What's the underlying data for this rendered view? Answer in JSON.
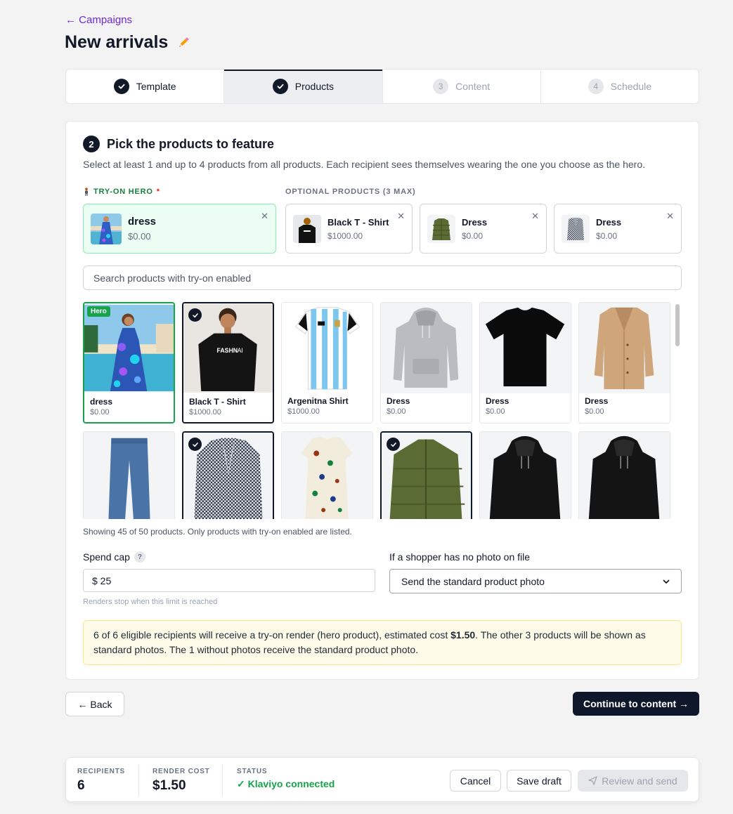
{
  "nav": {
    "back_link": "← Campaigns"
  },
  "page": {
    "title": "New arrivals"
  },
  "stepper": [
    {
      "label": "Template",
      "state": "done"
    },
    {
      "label": "Products",
      "state": "active"
    },
    {
      "label": "Content",
      "number": "3",
      "state": "pending"
    },
    {
      "label": "Schedule",
      "number": "4",
      "state": "pending"
    }
  ],
  "section": {
    "number": "2",
    "title": "Pick the products to feature",
    "description": "Select at least 1 and up to 4 products from all products. Each recipient sees themselves wearing the one you choose as the hero."
  },
  "hero_label": "TRY-ON HERO",
  "hero_required": "*",
  "optional_label": "OPTIONAL PRODUCTS (3 MAX)",
  "hero_slot": {
    "name": "dress",
    "price": "$0.00"
  },
  "optional_slots": [
    {
      "name": "Black T - Shirt",
      "price": "$1000.00"
    },
    {
      "name": "Dress",
      "price": "$0.00"
    },
    {
      "name": "Dress",
      "price": "$0.00"
    }
  ],
  "search": {
    "placeholder": "Search products with try-on enabled"
  },
  "products": [
    {
      "name": "dress",
      "price": "$0.00",
      "state": "hero",
      "badge": "Hero",
      "image": "floral-dress"
    },
    {
      "name": "Black T - Shirt",
      "price": "$1000.00",
      "state": "selected",
      "image": "black-tshirt-model"
    },
    {
      "name": "Argenitna Shirt",
      "price": "$1000.00",
      "state": "none",
      "image": "argentina-jersey"
    },
    {
      "name": "Dress",
      "price": "$0.00",
      "state": "none",
      "image": "grey-hoodie"
    },
    {
      "name": "Dress",
      "price": "$0.00",
      "state": "none",
      "image": "black-tshirt"
    },
    {
      "name": "Dress",
      "price": "$0.00",
      "state": "none",
      "image": "camel-coat"
    },
    {
      "name": "",
      "price": "",
      "state": "none",
      "image": "jeans"
    },
    {
      "name": "",
      "price": "",
      "state": "selected",
      "image": "houndstooth-blazer"
    },
    {
      "name": "",
      "price": "",
      "state": "none",
      "image": "print-dress"
    },
    {
      "name": "",
      "price": "",
      "state": "selected",
      "image": "green-puffer"
    },
    {
      "name": "",
      "price": "",
      "state": "none",
      "image": "black-hoodie"
    },
    {
      "name": "",
      "price": "",
      "state": "none",
      "image": "black-hoodie"
    }
  ],
  "showing_text": "Showing 45 of 50 products. Only products with try-on enabled are listed.",
  "spend_cap": {
    "label": "Spend cap",
    "help": "?",
    "value": "$ 25",
    "hint": "Renders stop when this limit is reached"
  },
  "no_photo": {
    "label": "If a shopper has no photo on file",
    "selected": "Send the standard product photo"
  },
  "notice": {
    "before": "6 of 6 eligible recipients will receive a try-on render (hero product), estimated cost ",
    "cost": "$1.50",
    "after": ". The other 3 products will be shown as standard photos. The 1 without photos receive the standard product photo."
  },
  "buttons": {
    "back": "← Back",
    "continue": "Continue to content →"
  },
  "footer": {
    "recipients_label": "RECIPIENTS",
    "recipients_value": "6",
    "cost_label": "RENDER COST",
    "cost_value": "$1.50",
    "status_label": "STATUS",
    "status_value": "✓ Klaviyo connected",
    "cancel": "Cancel",
    "save_draft": "Save draft",
    "review": "Review and send"
  },
  "colors": {
    "accent": "#6d28d9",
    "primary": "#0f172a",
    "success": "#16a34a",
    "notice_bg": "#fefce8"
  }
}
